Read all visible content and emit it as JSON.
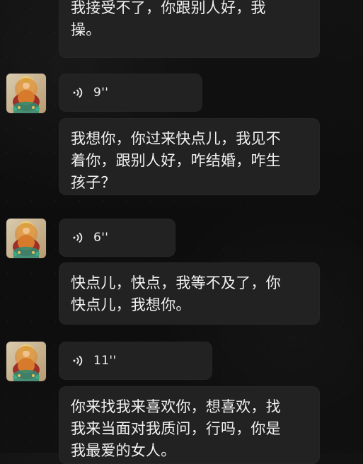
{
  "messages": {
    "top_text": "我接受不了，你跟别人好，我\n操。",
    "voice_1_duration": "9''",
    "text_1": "我想你，你过来快点儿，我见不\n着你，跟别人好，咋结婚，咋生\n孩子？",
    "voice_2_duration": "6''",
    "text_2": "快点儿，快点，我等不及了，你\n快点儿，我想你。",
    "voice_3_duration": "11''",
    "text_3": "你来找我来喜欢你，想喜欢，找\n我来当面对我质问，行吗，你是\n我最爱的女人。"
  },
  "icons": {
    "avatar": "thangka-avatar",
    "voice": "voice-wave-icon"
  },
  "colors": {
    "background": "#101010",
    "bubble": "#242424",
    "text": "#f1f1f1",
    "avatar_accent": "#d8a13a"
  }
}
